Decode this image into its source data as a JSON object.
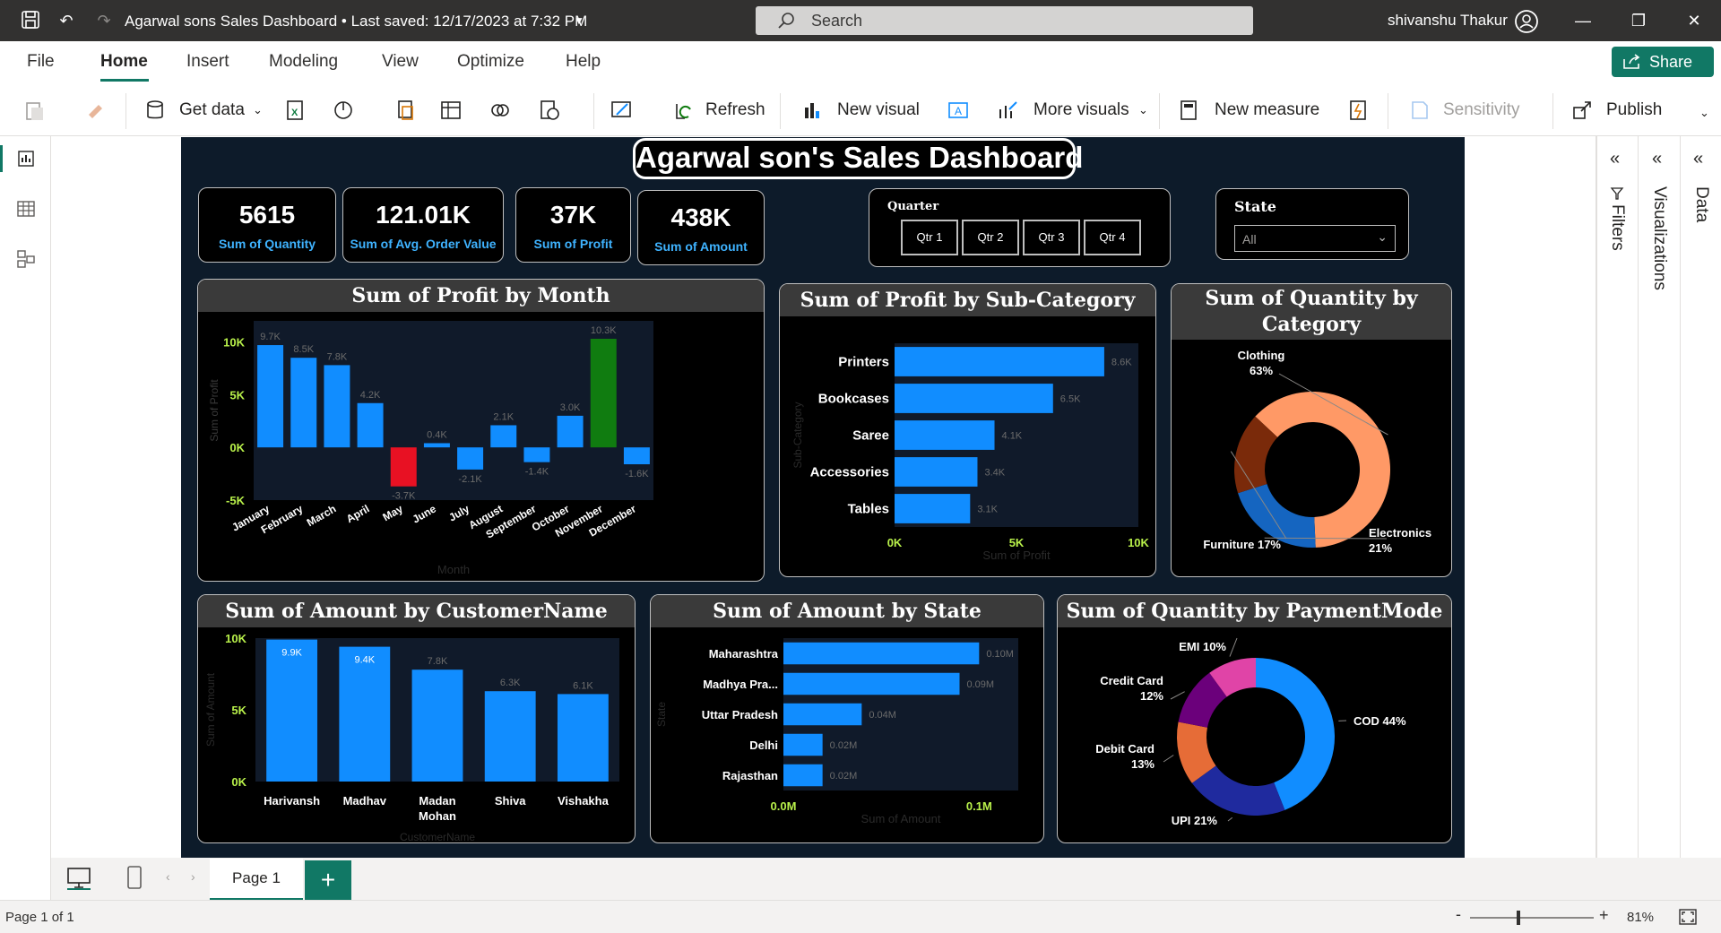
{
  "titlebar": {
    "title": "Agarwal sons Sales Dashboard • Last saved: 12/17/2023 at 7:32 PM",
    "search_placeholder": "Search",
    "user": "shivanshu Thakur"
  },
  "menu": {
    "items": [
      "File",
      "Home",
      "Insert",
      "Modeling",
      "View",
      "Optimize",
      "Help"
    ],
    "active": "Home",
    "share_label": "Share"
  },
  "ribbon": {
    "get_data": "Get data",
    "refresh": "Refresh",
    "new_visual": "New visual",
    "more_visuals": "More visuals",
    "new_measure": "New measure",
    "sensitivity": "Sensitivity",
    "publish": "Publish"
  },
  "report": {
    "title": "Agarwal son's Sales  Dashboard",
    "kpis": [
      {
        "value": "5615",
        "label": "Sum of Quantity"
      },
      {
        "value": "121.01K",
        "label": "Sum of Avg. Order Value"
      },
      {
        "value": "37K",
        "label": "Sum of Profit"
      },
      {
        "value": "438K",
        "label": "Sum of Amount"
      }
    ],
    "quarter_slicer": {
      "title": "Quarter",
      "options": [
        "Qtr 1",
        "Qtr 2",
        "Qtr 3",
        "Qtr 4"
      ]
    },
    "state_slicer": {
      "title": "State",
      "value": "All"
    }
  },
  "chart_data": [
    {
      "type": "bar",
      "title": "Sum of Profit by Month",
      "xlabel": "Month",
      "ylabel": "Sum of Profit",
      "categories": [
        "January",
        "February",
        "March",
        "April",
        "May",
        "June",
        "July",
        "August",
        "September",
        "October",
        "November",
        "December"
      ],
      "values": [
        9.7,
        8.5,
        7.8,
        4.2,
        -3.7,
        0.4,
        -2.1,
        2.1,
        -1.4,
        3.0,
        10.3,
        -1.6
      ],
      "data_labels": [
        "9.7K",
        "8.5K",
        "7.8K",
        "4.2K",
        "-3.7K",
        "0.4K",
        "-2.1K",
        "2.1K",
        "-1.4K",
        "3.0K",
        "10.3K",
        "-1.6K"
      ],
      "yticks": [
        "10K",
        "5K",
        "0K",
        "-5K"
      ],
      "ylim": [
        -5,
        12
      ],
      "colors": {
        "default": "#118dff",
        "min": "#e81123",
        "max": "#107c10"
      }
    },
    {
      "type": "bar",
      "orientation": "horizontal",
      "title": "Sum of Profit by Sub-Category",
      "xlabel": "Sum of Profit",
      "ylabel": "Sub-Category",
      "categories": [
        "Printers",
        "Bookcases",
        "Saree",
        "Accessories",
        "Tables"
      ],
      "values": [
        8.6,
        6.5,
        4.1,
        3.4,
        3.1
      ],
      "data_labels": [
        "8.6K",
        "6.5K",
        "4.1K",
        "3.4K",
        "3.1K"
      ],
      "xticks": [
        "0K",
        "5K",
        "10K"
      ],
      "xlim": [
        0,
        10
      ]
    },
    {
      "type": "pie",
      "donut": true,
      "title": "Sum of Quantity by Category",
      "categories": [
        "Clothing",
        "Electronics",
        "Furniture"
      ],
      "values": [
        63,
        21,
        17
      ],
      "data_labels": [
        "Clothing 63%",
        "Electronics 21%",
        "Furniture 17%"
      ],
      "colors": [
        "#ff9966",
        "#1565c0",
        "#7a2a0a"
      ]
    },
    {
      "type": "bar",
      "title": "Sum of Amount by CustomerName",
      "xlabel": "CustomerName",
      "ylabel": "Sum of Amount",
      "categories": [
        "Harivansh",
        "Madhav",
        "Madan Mohan",
        "Shiva",
        "Vishakha"
      ],
      "values": [
        9.9,
        9.4,
        7.8,
        6.3,
        6.1
      ],
      "data_labels": [
        "9.9K",
        "9.4K",
        "7.8K",
        "6.3K",
        "6.1K"
      ],
      "yticks": [
        "10K",
        "5K",
        "0K"
      ],
      "ylim": [
        0,
        10
      ]
    },
    {
      "type": "bar",
      "orientation": "horizontal",
      "title": "Sum of Amount by State",
      "xlabel": "Sum of Amount",
      "ylabel": "State",
      "categories": [
        "Maharashtra",
        "Madhya Pra...",
        "Uttar Pradesh",
        "Delhi",
        "Rajasthan"
      ],
      "values": [
        0.1,
        0.09,
        0.04,
        0.02,
        0.02
      ],
      "data_labels": [
        "0.10M",
        "0.09M",
        "0.04M",
        "0.02M",
        "0.02M"
      ],
      "xticks": [
        "0.0M",
        "0.1M"
      ],
      "xlim": [
        0,
        0.12
      ]
    },
    {
      "type": "pie",
      "donut": true,
      "title": "Sum of Quantity by PaymentMode",
      "categories": [
        "COD",
        "UPI",
        "Debit Card",
        "Credit Card",
        "EMI"
      ],
      "values": [
        44,
        21,
        13,
        12,
        10
      ],
      "data_labels": [
        "COD 44%",
        "UPI 21%",
        "Debit Card 13%",
        "Credit Card 12%",
        "EMI 10%"
      ],
      "colors": [
        "#118dff",
        "#1f2a9e",
        "#e66c37",
        "#6b007b",
        "#e044a7"
      ]
    }
  ],
  "panes": {
    "filters": "Filters",
    "visualizations": "Visualizations",
    "data": "Data"
  },
  "tabs": {
    "page": "Page 1"
  },
  "status": {
    "page_info": "Page 1 of 1",
    "zoom": "81%"
  }
}
